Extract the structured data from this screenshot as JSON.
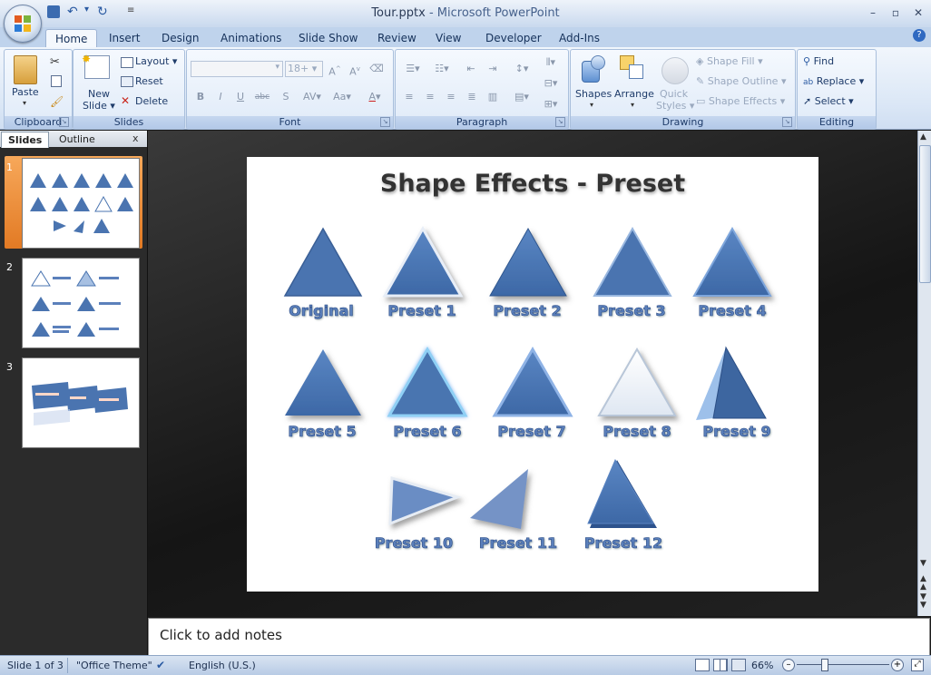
{
  "window": {
    "title": "Tour.pptx",
    "app_suffix": " - Microsoft PowerPoint"
  },
  "tabs": [
    "Home",
    "Insert",
    "Design",
    "Animations",
    "Slide Show",
    "Review",
    "View",
    "Developer",
    "Add-Ins"
  ],
  "ribbon": {
    "clipboard": {
      "label": "Clipboard",
      "paste": "Paste"
    },
    "slides": {
      "label": "Slides",
      "new_slide_1": "New",
      "new_slide_2": "Slide",
      "layout": "Layout",
      "reset": "Reset",
      "delete": "Delete"
    },
    "font": {
      "label": "Font",
      "size": "18+",
      "bold": "B",
      "italic": "I",
      "underline": "U",
      "strike": "abc",
      "shadow": "S",
      "spacing": "AV",
      "case": "Aa",
      "color": "A"
    },
    "paragraph": {
      "label": "Paragraph"
    },
    "drawing": {
      "label": "Drawing",
      "shapes": "Shapes",
      "arrange": "Arrange",
      "quick_styles_1": "Quick",
      "quick_styles_2": "Styles",
      "shape_fill": "Shape Fill",
      "shape_outline": "Shape Outline",
      "shape_effects": "Shape Effects"
    },
    "editing": {
      "label": "Editing",
      "find": "Find",
      "replace": "Replace",
      "select": "Select"
    }
  },
  "left_pane": {
    "tab_slides": "Slides",
    "tab_outline": "Outline",
    "close": "x",
    "thumb_numbers": [
      "1",
      "2",
      "3"
    ]
  },
  "slide": {
    "title": "Shape Effects - Preset",
    "labels": [
      "Original",
      "Preset 1",
      "Preset 2",
      "Preset 3",
      "Preset 4",
      "Preset 5",
      "Preset 6",
      "Preset 7",
      "Preset 8",
      "Preset 9",
      "Preset 10",
      "Preset 11",
      "Preset 12"
    ]
  },
  "notes": {
    "placeholder": "Click to add notes"
  },
  "status": {
    "slide": "Slide 1 of 3",
    "theme": "\"Office Theme\"",
    "language": "English (U.S.)",
    "zoom": "66%"
  },
  "colors": {
    "accent": "#4f81bd",
    "slide_bg": "#ffffff",
    "shape_fill": "#4a74b0"
  }
}
